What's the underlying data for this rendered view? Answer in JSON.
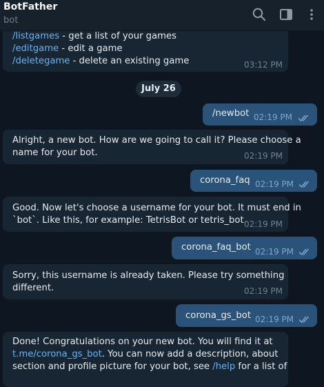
{
  "header": {
    "title": "BotFather",
    "subtitle": "bot",
    "icons": [
      "search-icon",
      "sidebar-panel-icon",
      "more-vertical-icon"
    ]
  },
  "colors": {
    "background": "#0e1621",
    "header": "#17212b",
    "incoming_bubble": "#182533",
    "outgoing_bubble": "#2b5278",
    "link": "#6ab3f3"
  },
  "messages": {
    "m0": {
      "direction": "incoming",
      "lines": [
        {
          "cmd": "/listgames",
          "rest": " - get a list of your games"
        },
        {
          "cmd": "/editgame",
          "rest": " - edit a game"
        },
        {
          "cmd": "/deletegame",
          "rest": " - delete an existing game"
        }
      ],
      "time": "03:12 PM"
    },
    "date_separator": "July 26",
    "m1": {
      "direction": "outgoing",
      "text": "/newbot",
      "time": "02:19 PM",
      "read": true
    },
    "m2": {
      "direction": "incoming",
      "lines": [
        "Alright, a new bot. How are we going to call it? Please choose a",
        "name for your bot."
      ],
      "time": "02:19 PM"
    },
    "m3": {
      "direction": "outgoing",
      "text": "corona_faq",
      "time": "02:19 PM",
      "read": true
    },
    "m4": {
      "direction": "incoming",
      "lines": [
        "Good. Now let's choose a username for your bot. It must end in",
        "`bot`. Like this, for example: TetrisBot or tetris_bot."
      ],
      "time": "02:19 PM"
    },
    "m5": {
      "direction": "outgoing",
      "text": "corona_faq_bot",
      "time": "02:19 PM",
      "read": true
    },
    "m6": {
      "direction": "incoming",
      "lines": [
        "Sorry, this username is already taken. Please try something",
        "different."
      ],
      "time": "02:19 PM"
    },
    "m7": {
      "direction": "outgoing",
      "text": "corona_gs_bot",
      "time": "02:19 PM",
      "read": true
    },
    "m8": {
      "direction": "incoming",
      "line1": "Done! Congratulations on your new bot. You will find it at",
      "link1": "t.me/corona_gs_bot",
      "line2_rest": ". You can now add a description, about",
      "line3_a": "section and profile picture for your bot, see ",
      "link2": "/help",
      "line3_b": " for a list of"
    }
  }
}
